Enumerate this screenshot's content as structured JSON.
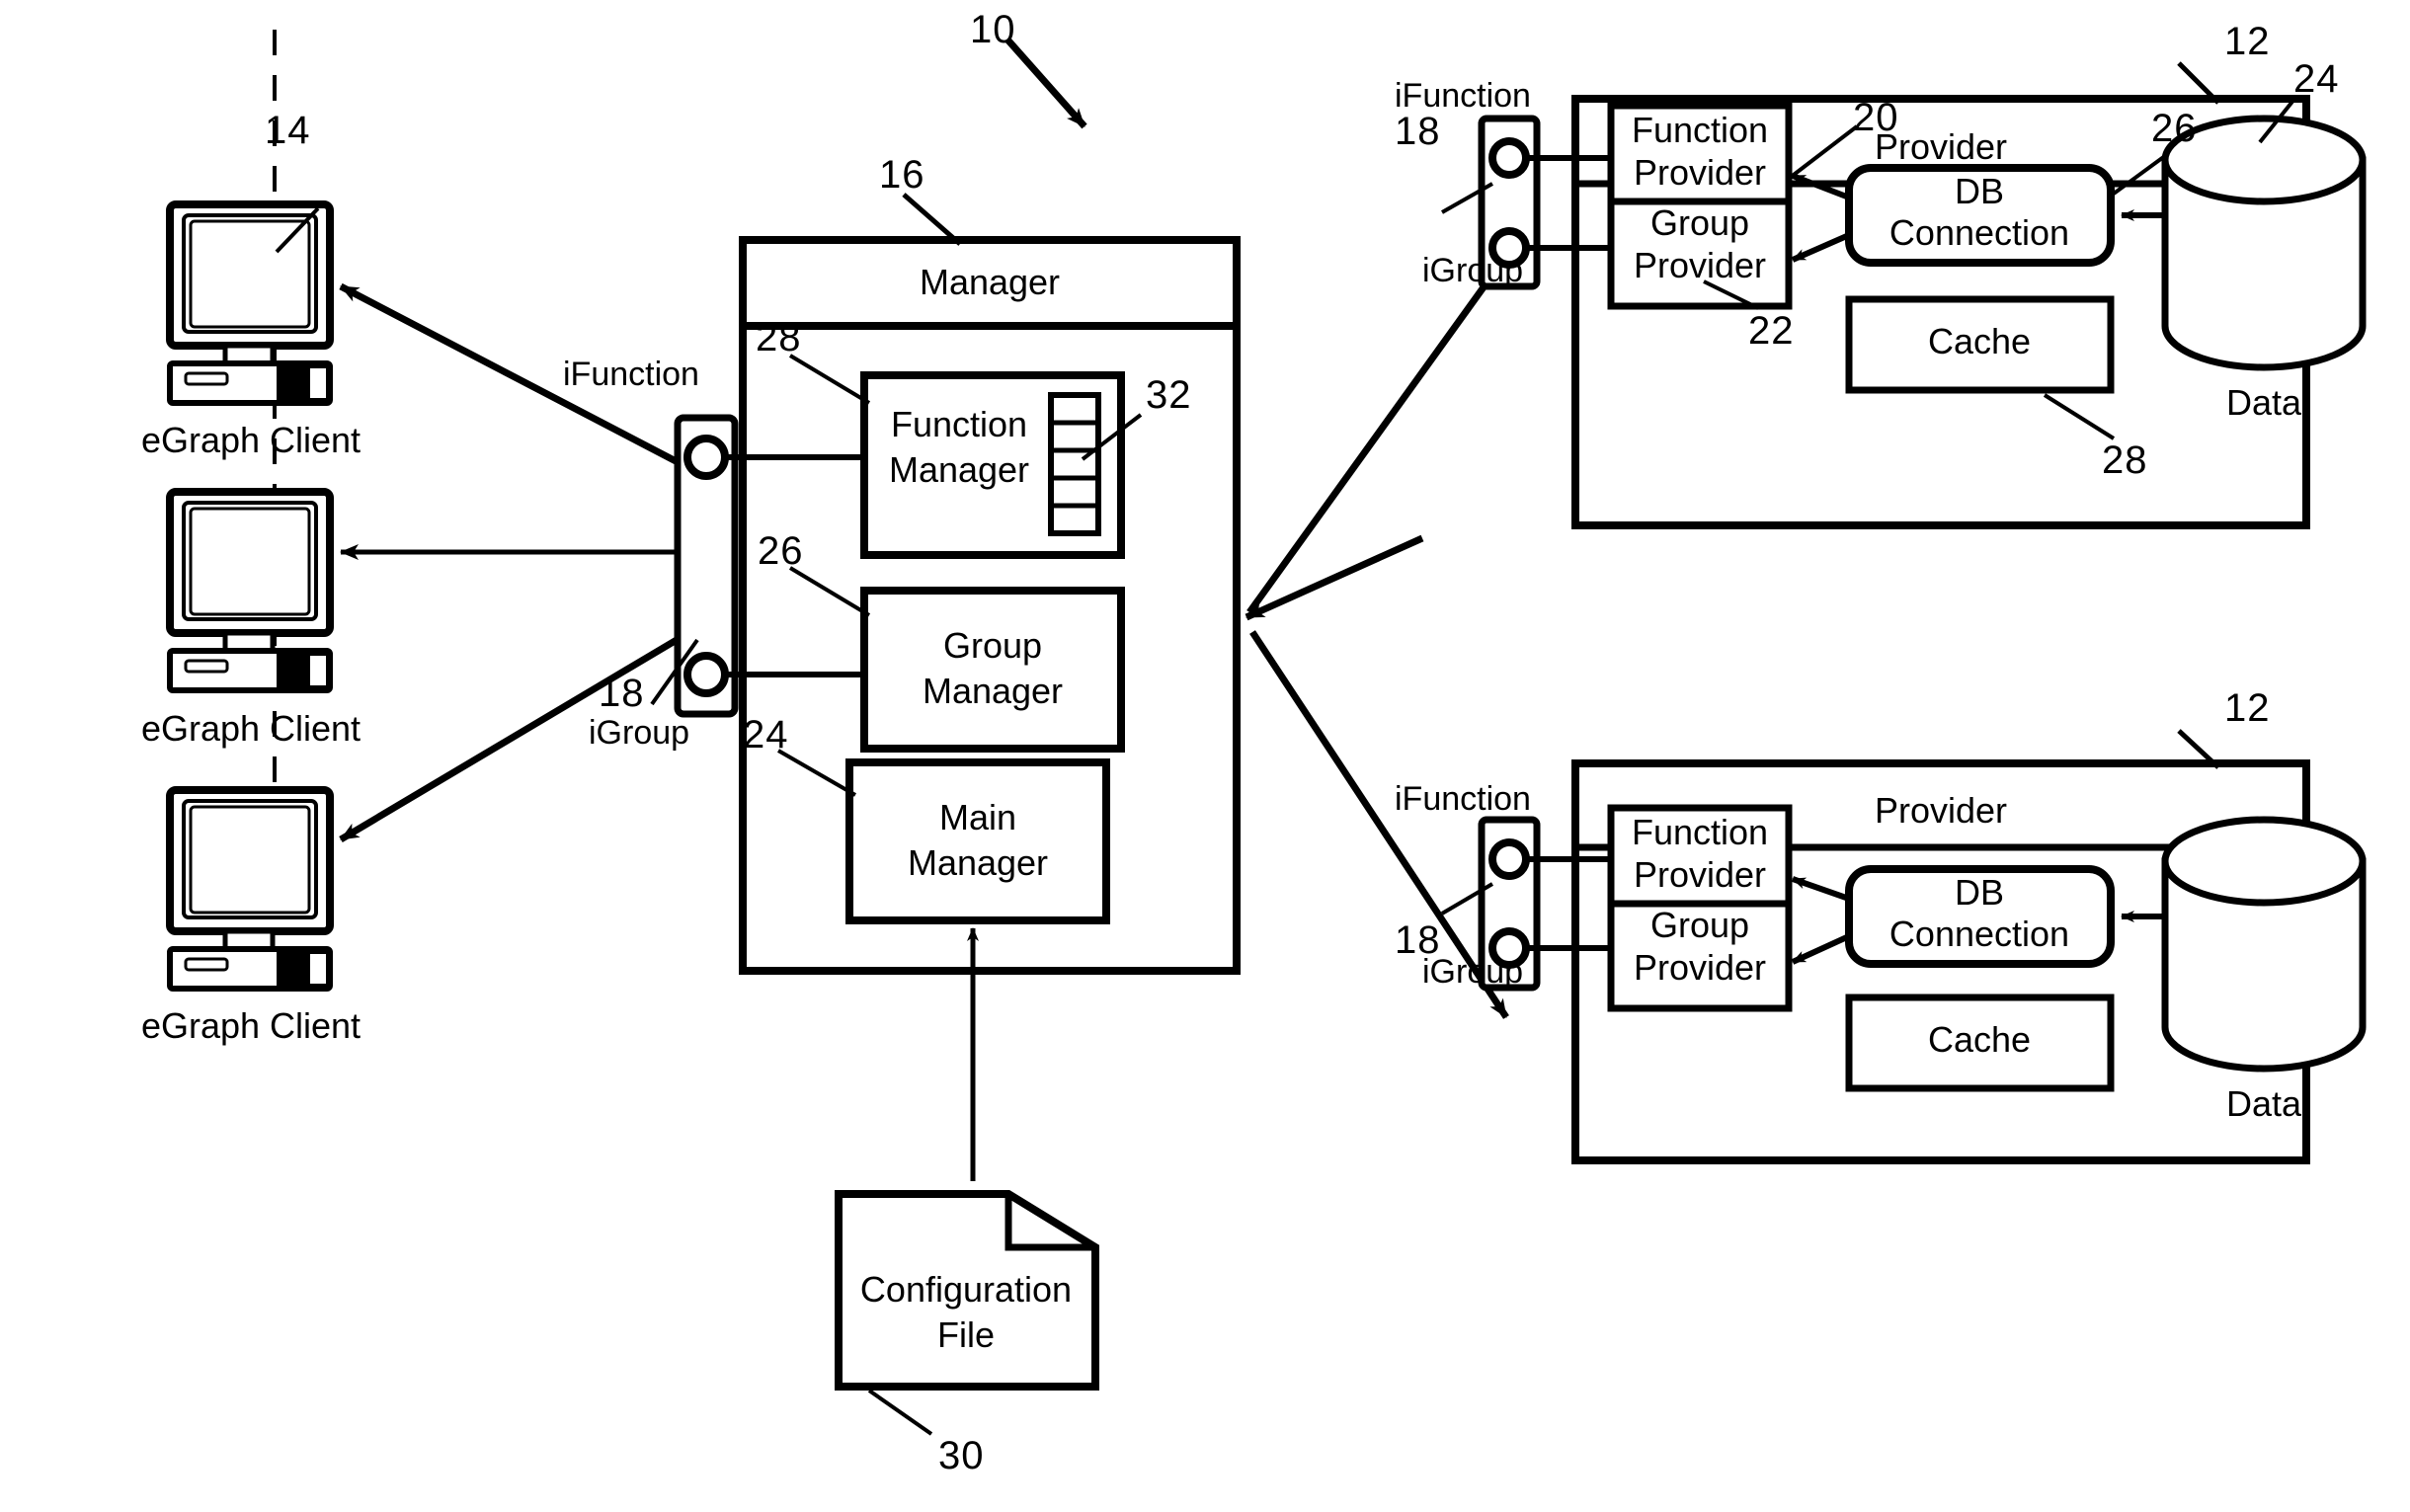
{
  "figure": {
    "ref_main": "10",
    "domain": "patent-architecture-diagram"
  },
  "clients": {
    "ref": "14",
    "items": [
      {
        "label": "eGraph  Client"
      },
      {
        "label": "eGraph  Client"
      },
      {
        "label": "eGraph  Client"
      }
    ]
  },
  "manager": {
    "ref": "16",
    "title": "Manager",
    "interface": {
      "ref": "18",
      "top_label": "iFunction",
      "bottom_label": "iGroup"
    },
    "components": [
      {
        "ref": "28",
        "label_line1": "Function",
        "label_line2": "Manager",
        "stack_ref": "32",
        "stack_count": 5
      },
      {
        "ref": "26",
        "label_line1": "Group",
        "label_line2": "Manager"
      },
      {
        "ref": "24",
        "label_line1": "Main",
        "label_line2": "Manager"
      }
    ]
  },
  "config_file": {
    "ref": "30",
    "label_line1": "Configuration",
    "label_line2": "File"
  },
  "providers": [
    {
      "ref": "12",
      "title": "Provider",
      "interface": {
        "ref": "18",
        "top_label": "iFunction",
        "bottom_label": "iGroup"
      },
      "function_provider": {
        "ref": "20",
        "label_line1": "Function",
        "label_line2": "Provider"
      },
      "group_provider": {
        "ref": "22",
        "label_line1": "Group",
        "label_line2": "Provider"
      },
      "db_connection": {
        "ref": "26",
        "label_line1": "DB",
        "label_line2": "Connection"
      },
      "cache": {
        "ref": "28",
        "label": "Cache"
      },
      "data": {
        "ref": "24",
        "label": "Data"
      }
    },
    {
      "ref": "12",
      "title": "Provider",
      "interface": {
        "ref": "18",
        "top_label": "iFunction",
        "bottom_label": "iGroup"
      },
      "function_provider": {
        "ref": "",
        "label_line1": "Function",
        "label_line2": "Provider"
      },
      "group_provider": {
        "ref": "",
        "label_line1": "Group",
        "label_line2": "Provider"
      },
      "db_connection": {
        "ref": "",
        "label_line1": "DB",
        "label_line2": "Connection"
      },
      "cache": {
        "ref": "",
        "label": "Cache"
      },
      "data": {
        "ref": "",
        "label": "Data"
      }
    }
  ],
  "colors": {
    "ink": "#000000",
    "paper": "#ffffff"
  }
}
